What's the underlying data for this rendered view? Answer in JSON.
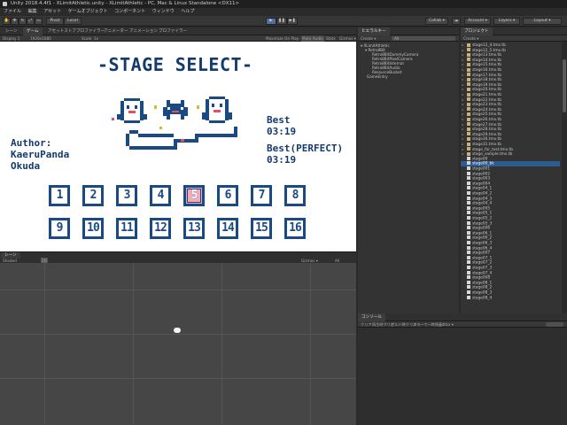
{
  "window": {
    "title": "Unity 2018.4.4f1 - XLimitAthletic.unity - XLimitAthletic - PC, Mac & Linux Standalone <DX11>",
    "menu": [
      "ファイル",
      "編集",
      "アセット",
      "ゲームオブジェクト",
      "コンポーネント",
      "ウィンドウ",
      "ヘルプ"
    ]
  },
  "toolbar": {
    "pivot": "Pivot",
    "local": "Local",
    "collab": "Collab ▾",
    "account": "Account ▾",
    "layers": "Layers ▾",
    "layout": "Layout ▾"
  },
  "game_view": {
    "tabs": [
      "シーン",
      "ゲーム",
      "アセットストア",
      "プロファイラー",
      "アニメーター",
      "アニメーション",
      "プロファイラー"
    ],
    "subbar": [
      "Display 1",
      "1920x1080",
      "Scale",
      "1x",
      "Maximize On Play",
      "Mute Audio",
      "Stats",
      "Gizmos ▾"
    ],
    "title": "-STAGE SELECT-",
    "author_label": "Author:",
    "author_name_1": "KaeruPanda",
    "author_name_2": "Okuda",
    "best_label": "Best",
    "best_time": "03:19",
    "best_perfect_label": "Best(PERFECT)",
    "best_perfect_time": "03:19",
    "stages_row1": [
      "1",
      "2",
      "3",
      "4",
      "5",
      "6",
      "7",
      "8"
    ],
    "stages_row2": [
      "9",
      "10",
      "11",
      "12",
      "13",
      "14",
      "15",
      "16"
    ],
    "selected_stage": "5"
  },
  "scene_view": {
    "tab": "シーン",
    "subbar": [
      "Shaded",
      "2D",
      "Gizmos ▾",
      "All"
    ]
  },
  "hierarchy": {
    "tab": "ヒエラルキー",
    "create": "Create ▾",
    "search_placeholder": "All",
    "rows": [
      "XLimitAthletic",
      "Retro8Bit",
      "Retro8BitDummyCamera",
      "Retro8BitPixelCamera",
      "Retro8BitInternal",
      "Retro8BitAudio",
      "ResourceBucket",
      "GameEntry"
    ]
  },
  "project": {
    "tab": "プロジェクト",
    "create": "Create ▾",
    "rows": [
      {
        "label": "stage12_4.tmx.tb",
        "type": "folder"
      },
      {
        "label": "stage12_5.tmx.tb",
        "type": "folder"
      },
      {
        "label": "stage13.tmx.tb",
        "type": "folder"
      },
      {
        "label": "stage14.tmx.tb",
        "type": "folder"
      },
      {
        "label": "stage15.tmx.tb",
        "type": "folder"
      },
      {
        "label": "stage16.tmx.tb",
        "type": "folder"
      },
      {
        "label": "stage17.tmx.tb",
        "type": "folder"
      },
      {
        "label": "stage18.tmx.tb",
        "type": "folder"
      },
      {
        "label": "stage19.tmx.tb",
        "type": "folder"
      },
      {
        "label": "stage20.tmx.tb",
        "type": "folder"
      },
      {
        "label": "stage21.tmx.tb",
        "type": "folder"
      },
      {
        "label": "stage22.tmx.tb",
        "type": "folder"
      },
      {
        "label": "stage23.tmx.tb",
        "type": "folder"
      },
      {
        "label": "stage24.tmx.tb",
        "type": "folder"
      },
      {
        "label": "stage25.tmx.tb",
        "type": "folder"
      },
      {
        "label": "stage26.tmx.tb",
        "type": "folder"
      },
      {
        "label": "stage27.tmx.tb",
        "type": "folder"
      },
      {
        "label": "stage28.tmx.tb",
        "type": "folder"
      },
      {
        "label": "stage29.tmx.tb",
        "type": "folder"
      },
      {
        "label": "stage30.tmx.tb",
        "type": "folder"
      },
      {
        "label": "stage31.tmx.tb",
        "type": "folder"
      },
      {
        "label": "stage_for_test.tmx.tb",
        "type": "folder"
      },
      {
        "label": "stage_sample.tmx.tb",
        "type": "folder"
      },
      {
        "label": "stage00",
        "type": "file"
      },
      {
        "label": "stage00_bk",
        "type": "file",
        "selected": true
      },
      {
        "label": "stage001",
        "type": "file"
      },
      {
        "label": "stage002",
        "type": "file"
      },
      {
        "label": "stage003",
        "type": "file"
      },
      {
        "label": "stage004",
        "type": "file"
      },
      {
        "label": "stage04_1",
        "type": "file"
      },
      {
        "label": "stage04_2",
        "type": "file"
      },
      {
        "label": "stage04_3",
        "type": "file"
      },
      {
        "label": "stage04_4",
        "type": "file"
      },
      {
        "label": "stage005",
        "type": "file"
      },
      {
        "label": "stage05_1",
        "type": "file"
      },
      {
        "label": "stage05_2",
        "type": "file"
      },
      {
        "label": "stage05_3",
        "type": "file"
      },
      {
        "label": "stage006",
        "type": "file"
      },
      {
        "label": "stage06_1",
        "type": "file"
      },
      {
        "label": "stage06_2",
        "type": "file"
      },
      {
        "label": "stage06_3",
        "type": "file"
      },
      {
        "label": "stage06_4",
        "type": "file"
      },
      {
        "label": "stage007",
        "type": "file"
      },
      {
        "label": "stage07_1",
        "type": "file"
      },
      {
        "label": "stage07_2",
        "type": "file"
      },
      {
        "label": "stage07_3",
        "type": "file"
      },
      {
        "label": "stage07_4",
        "type": "file"
      },
      {
        "label": "stage008",
        "type": "file"
      },
      {
        "label": "stage08_1",
        "type": "file"
      },
      {
        "label": "stage08_2",
        "type": "file"
      },
      {
        "label": "stage08_3",
        "type": "file"
      },
      {
        "label": "stage08_4",
        "type": "file"
      }
    ]
  },
  "console": {
    "tab": "コンソール",
    "buttons": [
      "クリア",
      "再生時クリア",
      "ビルド時クリア",
      "エラーで一時停止",
      "Editor ▾"
    ]
  }
}
